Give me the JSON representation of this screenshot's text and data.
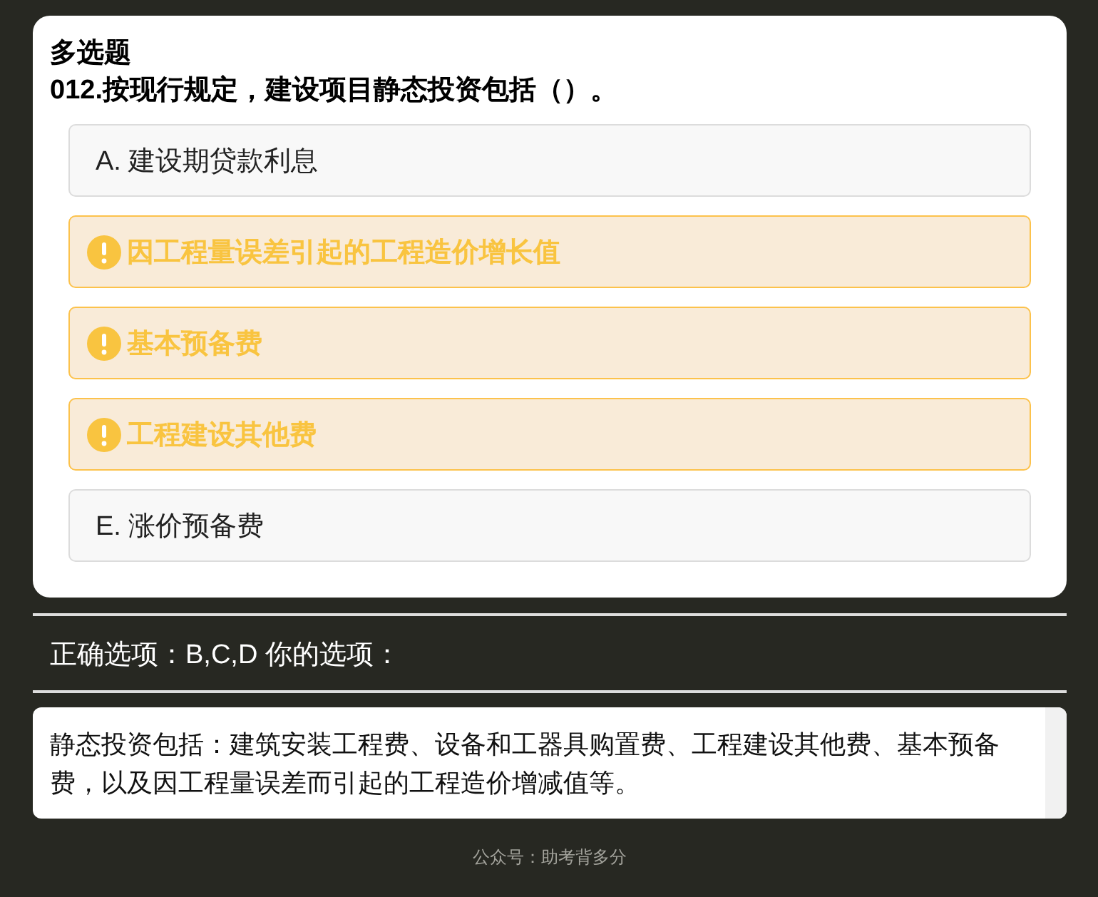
{
  "question": {
    "type": "多选题",
    "title": "012.按现行规定，建设项目静态投资包括（）。"
  },
  "options": [
    {
      "text": "A. 建设期贷款利息",
      "missed": false
    },
    {
      "text": "因工程量误差引起的工程造价增长值",
      "missed": true
    },
    {
      "text": "基本预备费",
      "missed": true
    },
    {
      "text": "工程建设其他费",
      "missed": true
    },
    {
      "text": "E. 涨价预备费",
      "missed": false
    }
  ],
  "answer_line": "正确选项：B,C,D 你的选项：",
  "explanation": "静态投资包括：建筑安装工程费、设备和工器具购置费、工程建设其他费、基本预备费，以及因工程量误差而引起的工程造价增减值等。",
  "footer": "公众号：助考背多分"
}
